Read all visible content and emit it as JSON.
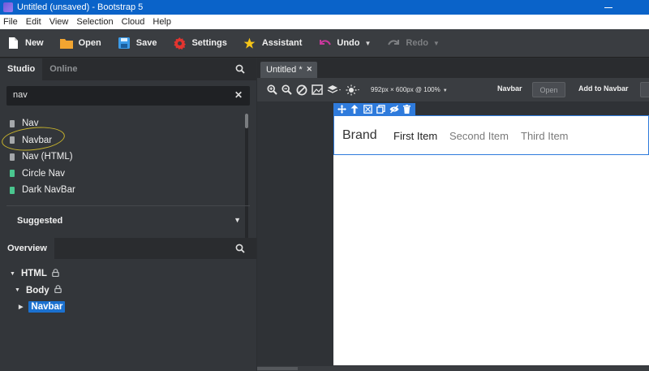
{
  "window": {
    "title": "Untitled (unsaved) - Bootstrap 5"
  },
  "menu": [
    "File",
    "Edit",
    "View",
    "Selection",
    "Cloud",
    "Help"
  ],
  "toolbar": {
    "new_label": "New",
    "open_label": "Open",
    "save_label": "Save",
    "settings_label": "Settings",
    "assistant_label": "Assistant",
    "undo_label": "Undo",
    "redo_label": "Redo"
  },
  "studio_panel": {
    "tabs": [
      "Studio",
      "Online"
    ],
    "search_value": "nav",
    "results": [
      {
        "label": "Nav",
        "color": "grey"
      },
      {
        "label": "Navbar",
        "color": "grey"
      },
      {
        "label": "Nav (HTML)",
        "color": "grey"
      },
      {
        "label": "Circle Nav",
        "color": "green"
      },
      {
        "label": "Dark NavBar",
        "color": "green"
      }
    ],
    "suggested_label": "Suggested"
  },
  "overview_panel": {
    "tab": "Overview",
    "tree": [
      {
        "label": "HTML",
        "level": 0,
        "locked": true
      },
      {
        "label": "Body",
        "level": 1,
        "locked": true
      },
      {
        "label": "Navbar",
        "level": 2,
        "locked": false,
        "selected": true
      }
    ]
  },
  "editor": {
    "tab_label": "Untitled *",
    "size_readout": "992px × 600px @ 100%",
    "component_label": "Navbar",
    "open_button": "Open",
    "add_label": "Add to Navbar"
  },
  "preview": {
    "brand": "Brand",
    "items": [
      "First Item",
      "Second Item",
      "Third Item"
    ]
  },
  "colors": {
    "title_bar": "#0a63c9",
    "selection": "#2f7bdc",
    "highlight_ring": "#c8b42c",
    "green_doc": "#4ac68f"
  }
}
